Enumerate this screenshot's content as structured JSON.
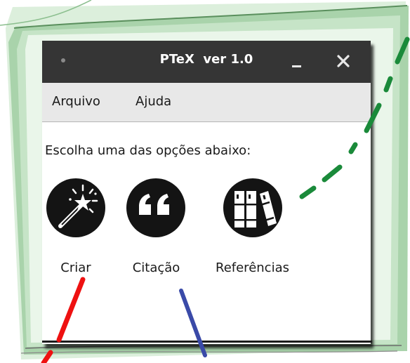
{
  "window": {
    "title": "PTeX  ver 1.0",
    "minimize_icon": "minimize-icon",
    "close_icon": "close-icon"
  },
  "menu": {
    "items": [
      {
        "label": "Arquivo"
      },
      {
        "label": "Ajuda"
      }
    ]
  },
  "main": {
    "prompt": "Escolha uma das opções abaixo:",
    "options": [
      {
        "label": "Criar",
        "icon": "magic-wand-icon"
      },
      {
        "label": "Citação",
        "icon": "quote-icon"
      },
      {
        "label": "Referências",
        "icon": "books-icon"
      }
    ]
  },
  "colors": {
    "titlebar": "#353535",
    "menubar": "#e8e8e8",
    "icon_circle": "#141414",
    "frame_green": "#9ecba3",
    "annotation_green": "#1a8a3a",
    "annotation_red": "#ee1111",
    "annotation_blue": "#3a4aa8"
  }
}
